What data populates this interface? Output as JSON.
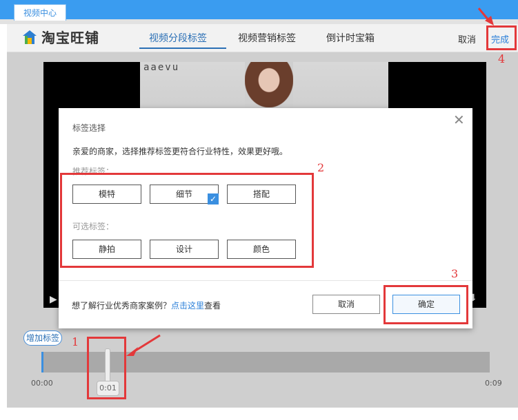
{
  "window": {
    "tab_label": "视频中心"
  },
  "header": {
    "logo_text": "淘宝旺铺",
    "tabs": [
      "视频分段标签",
      "视频营销标签",
      "倒计时宝箱"
    ],
    "cancel_label": "取消",
    "done_label": "完成"
  },
  "video": {
    "overlay_text": "aaevu"
  },
  "dialog": {
    "title": "标签选择",
    "description": "亲爱的商家，选择推荐标签更符合行业特性，效果更好哦。",
    "recommended_label": "推荐标签：",
    "recommended_tags": [
      {
        "label": "模特",
        "checked": false
      },
      {
        "label": "细节",
        "checked": true
      },
      {
        "label": "搭配",
        "checked": false
      }
    ],
    "optional_label": "可选标签：",
    "optional_tags": [
      {
        "label": "静拍"
      },
      {
        "label": "设计"
      },
      {
        "label": "颜色"
      }
    ],
    "footer_text_before": "想了解行业优秀商家案例？",
    "footer_link": "点击这里",
    "footer_text_after": "查看",
    "cancel_label": "取消",
    "ok_label": "确定"
  },
  "timeline": {
    "add_tag_label": "增加标签",
    "start_time": "00:00",
    "end_time": "0:09",
    "handle_time": "0:01"
  },
  "annotations": [
    "1",
    "2",
    "3",
    "4"
  ],
  "colors": {
    "accent": "#3a8fe0",
    "annotation_red": "#e3383a",
    "topbar_blue": "#3a9cf0"
  }
}
